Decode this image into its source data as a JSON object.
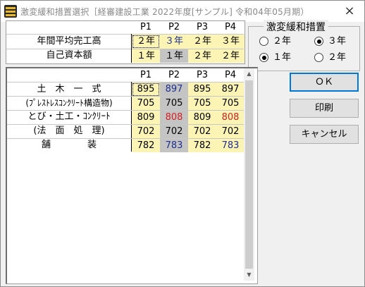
{
  "window": {
    "title": "激変緩和措置選択［経審建設工業 2022年度[サンプル] 令和04年05月期）",
    "close_glyph": "×"
  },
  "top_table": {
    "headers": [
      "P1",
      "P2",
      "P3",
      "P4"
    ],
    "rows": [
      {
        "label": "年間平均完工高",
        "cells": [
          "２年",
          "３年",
          "２年",
          "３年"
        ]
      },
      {
        "label": "自己資本額",
        "cells": [
          "１年",
          "１年",
          "２年",
          "２年"
        ]
      }
    ]
  },
  "group": {
    "title": "激変緩和措置",
    "options": [
      {
        "label": "２年",
        "checked": false
      },
      {
        "label": "３年",
        "checked": true
      },
      {
        "label": "１年",
        "checked": true
      },
      {
        "label": "２年",
        "checked": false
      }
    ]
  },
  "main_table": {
    "headers": [
      "P1",
      "P2",
      "P3",
      "P4"
    ],
    "rows": [
      {
        "label": "土　木　一　式",
        "cells": [
          "895",
          "897",
          "895",
          "897"
        ]
      },
      {
        "label": "(ﾌﾟﾚｽﾄﾚｽｺﾝｸﾘｰﾄ構造物)",
        "cells": [
          "705",
          "705",
          "705",
          "705"
        ]
      },
      {
        "label": "とび・土工・ｺﾝｸﾘｰﾄ",
        "cells": [
          "809",
          "808",
          "809",
          "808"
        ]
      },
      {
        "label": "(法　面　処　理)",
        "cells": [
          "702",
          "702",
          "702",
          "702"
        ]
      },
      {
        "label": "舗　　　　装",
        "cells": [
          "782",
          "783",
          "782",
          "783"
        ]
      }
    ]
  },
  "buttons": {
    "ok": "ＯＫ",
    "print": "印刷",
    "cancel": "キャンセル"
  },
  "colors": {
    "yellow_cell": "#fbf4b4",
    "gray_cell": "#c4c4c4",
    "red_value": "#d22020",
    "blue_value": "#1e2e8e"
  }
}
